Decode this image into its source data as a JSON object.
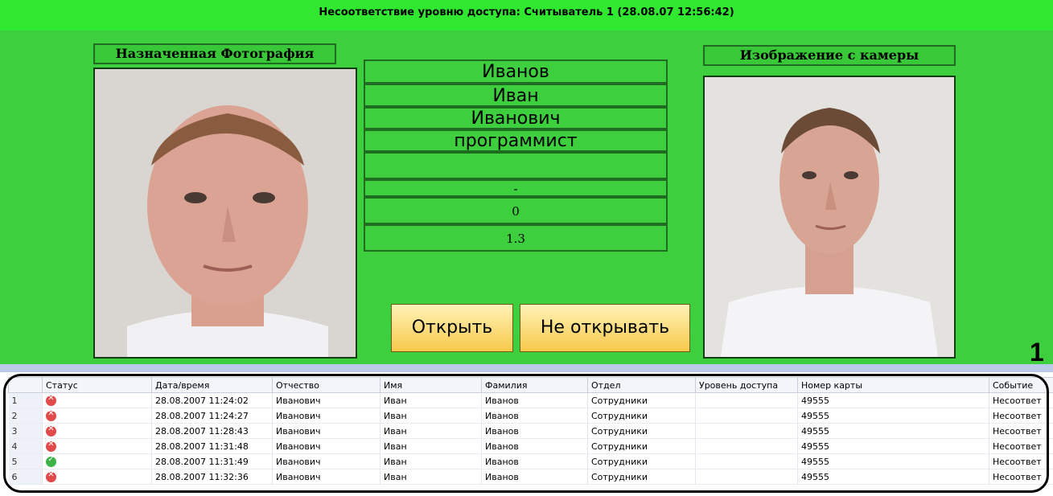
{
  "header": {
    "title": "Несоответствие уровню доступа: Считыватель 1 (28.08.07 12:56:42)"
  },
  "left_photo": {
    "caption": "Назначенная Фотография"
  },
  "right_photo": {
    "caption": "Изображение с камеры"
  },
  "fields": [
    "Иванов",
    "Иван",
    "Иванович",
    "программист",
    "",
    "-",
    "0",
    "1.3"
  ],
  "buttons": {
    "open": "Открыть",
    "dont_open": "Не открывать"
  },
  "marker": "1",
  "table": {
    "columns": [
      "",
      "Статус",
      "Дата/время",
      "Отчество",
      "Имя",
      "Фамилия",
      "Отдел",
      "Уровень доступа",
      "Номер карты",
      "Событие"
    ],
    "rows": [
      {
        "n": "1",
        "status": "error",
        "datetime": "28.08.2007 11:24:02",
        "patronymic": "Иванович",
        "name": "Иван",
        "surname": "Иванов",
        "dept": "Сотрудники",
        "level": "",
        "card": "49555",
        "event": "Несоответ"
      },
      {
        "n": "2",
        "status": "error",
        "datetime": "28.08.2007 11:24:27",
        "patronymic": "Иванович",
        "name": "Иван",
        "surname": "Иванов",
        "dept": "Сотрудники",
        "level": "",
        "card": "49555",
        "event": "Несоответ"
      },
      {
        "n": "3",
        "status": "error",
        "datetime": "28.08.2007 11:28:43",
        "patronymic": "Иванович",
        "name": "Иван",
        "surname": "Иванов",
        "dept": "Сотрудники",
        "level": "",
        "card": "49555",
        "event": "Несоответ"
      },
      {
        "n": "4",
        "status": "error",
        "datetime": "28.08.2007 11:31:48",
        "patronymic": "Иванович",
        "name": "Иван",
        "surname": "Иванов",
        "dept": "Сотрудники",
        "level": "",
        "card": "49555",
        "event": "Несоответ"
      },
      {
        "n": "5",
        "status": "ok",
        "datetime": "28.08.2007 11:31:49",
        "patronymic": "Иванович",
        "name": "Иван",
        "surname": "Иванов",
        "dept": "Сотрудники",
        "level": "",
        "card": "49555",
        "event": "Несоответ"
      },
      {
        "n": "6",
        "status": "error",
        "datetime": "28.08.2007 11:32:36",
        "patronymic": "Иванович",
        "name": "Иван",
        "surname": "Иванов",
        "dept": "Сотрудники",
        "level": "",
        "card": "49555",
        "event": "Несоответ"
      }
    ]
  },
  "colors": {
    "panel": "#3ecf3e",
    "title_bar": "#2fe82f",
    "button": "#f7c94a",
    "status_error": "#e04a4a",
    "status_ok": "#3db34a"
  },
  "icons": {
    "error": "error-circle-icon",
    "ok": "check-circle-icon"
  }
}
